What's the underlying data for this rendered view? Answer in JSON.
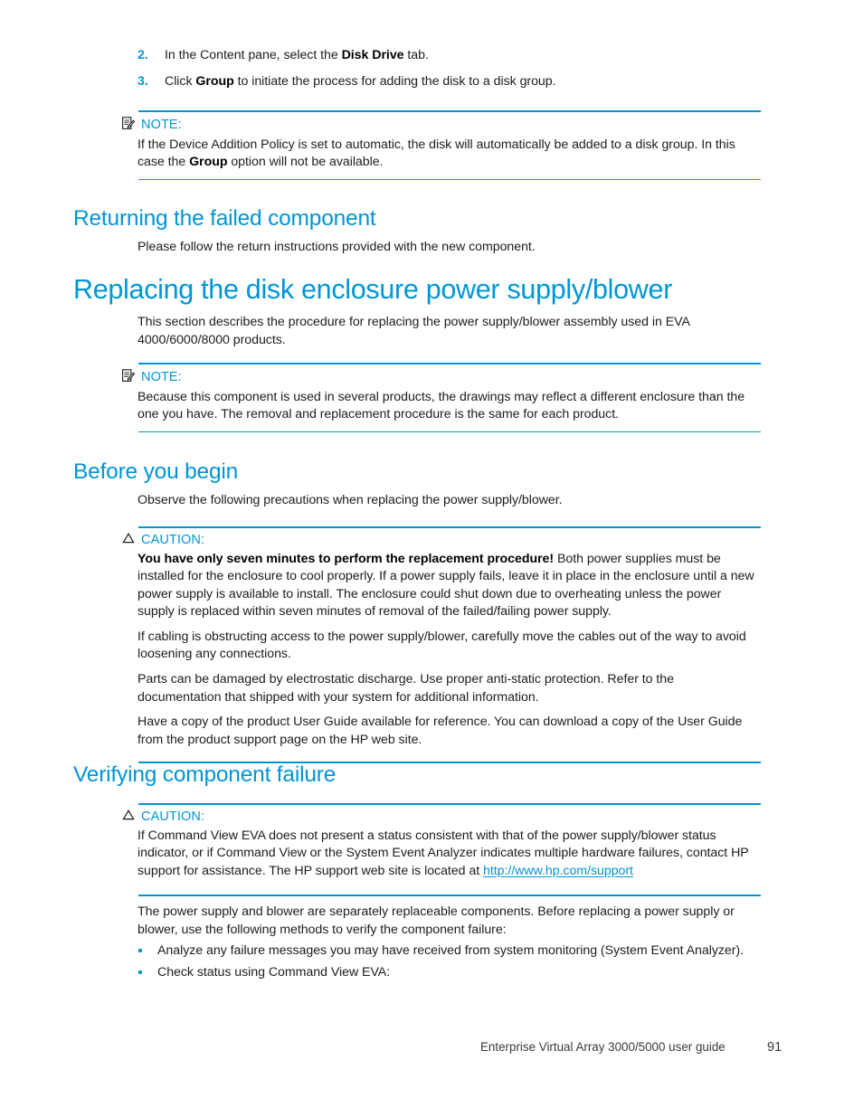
{
  "page": {
    "number": "91",
    "footer_title": "Enterprise Virtual Array 3000/5000 user guide",
    "accent_color": "#0096d6",
    "text_color": "#1d1d1d"
  },
  "steps": [
    {
      "number": "2.",
      "text_before": "In the Content pane, select the ",
      "bold": "Disk Drive",
      "text_after": " tab."
    },
    {
      "number": "3.",
      "text_before": "Click ",
      "bold": "Group",
      "text_after": " to initiate the process for adding the disk to a disk group."
    }
  ],
  "note_1": {
    "icon": "note-icon",
    "title": "NOTE:",
    "text_before": "If the Device Addition Policy is set to automatic, the disk will automatically be added to a disk group. In this case the ",
    "bold": "Group",
    "text_after": " option will not be available."
  },
  "heading_returning": "Returning the failed component",
  "returning_body": "Please follow the return instructions provided with the new component.",
  "heading_replacing": "Replacing the disk enclosure power supply/blower",
  "replacing_body": "This section describes the procedure for replacing the power supply/blower assembly used in EVA 4000/6000/8000 products.",
  "note_2": {
    "icon": "note-icon",
    "title": "NOTE:",
    "text": "Because this component is used in several products, the drawings may reflect a different enclosure than the one you have. The removal and replacement procedure is the same for each product."
  },
  "heading_before_you_begin": "Before you begin",
  "before_you_begin_body": "Observe the following precautions when replacing the power supply/blower.",
  "caution_1": {
    "icon": "caution-triangle-icon",
    "title": "CAUTION:",
    "para1_bold": "You have only seven minutes to perform the replacement procedure!",
    "para1_rest": " Both power supplies must be installed for the enclosure to cool properly. If a power supply fails, leave it in place in the enclosure until a new power supply is available to install. The enclosure could shut down due to overheating unless the power supply is replaced within seven minutes of removal of the failed/failing power supply.",
    "para2": "If cabling is obstructing access to the power supply/blower, carefully move the cables out of the way to avoid loosening any connections.",
    "para3": "Parts can be damaged by electrostatic discharge. Use proper anti-static protection. Refer to the documentation that shipped with your system for additional information.",
    "para4": "Have a copy of the product User Guide available for reference. You can download a copy of the User Guide from the product support page on the HP web site."
  },
  "heading_verifying": "Verifying component failure",
  "caution_2": {
    "icon": "caution-triangle-icon",
    "title": "CAUTION:",
    "text_before": "If Command View EVA does not present a status consistent with that of the power supply/blower status indicator, or if Command View or the System Event Analyzer indicates multiple hardware failures, contact HP support for assistance. The HP support web site is located at ",
    "link_text": "http://www.hp.com/support"
  },
  "verify_intro": "The power supply and blower are separately replaceable components. Before replacing a power supply or blower, use the following methods to verify the component failure:",
  "verify_bullets": [
    "Analyze any failure messages you may have received from system monitoring (System Event Analyzer).",
    "Check status using Command View EVA:"
  ]
}
